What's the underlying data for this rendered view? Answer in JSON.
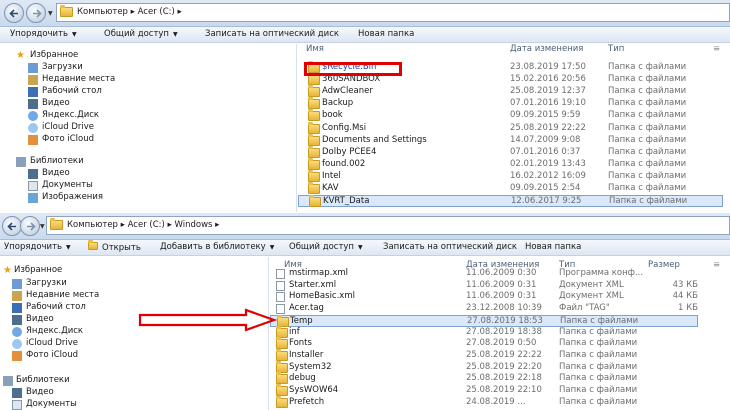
{
  "top": {
    "crumbs": [
      "Компьютер",
      "Acer (C:)"
    ],
    "toolbar": [
      "Упорядочить",
      "Общий доступ",
      "Записать на оптический диск",
      "Новая папка"
    ],
    "columns": {
      "name": "Имя",
      "date": "Дата изменения",
      "type": "Тип"
    },
    "nav": [
      {
        "label": "Избранное",
        "icon": "star-icon"
      },
      {
        "label": "Загрузки",
        "icon": "downloads-icon"
      },
      {
        "label": "Недавние места",
        "icon": "recent-places-icon"
      },
      {
        "label": "Рабочий стол",
        "icon": "desktop-icon"
      },
      {
        "label": "Видео",
        "icon": "video-icon"
      },
      {
        "label": "Яндекс.Диск",
        "icon": "yandex-disk-icon"
      },
      {
        "label": "iCloud Drive",
        "icon": "icloud-icon"
      },
      {
        "label": "Фото iCloud",
        "icon": "icloud-photos-icon"
      },
      {
        "label": "Библиотеки",
        "icon": "libraries-icon"
      },
      {
        "label": "Видео",
        "icon": "video-icon"
      },
      {
        "label": "Документы",
        "icon": "documents-icon"
      },
      {
        "label": "Изображения",
        "icon": "pictures-icon"
      }
    ],
    "files": [
      {
        "name": "$Recycle.Bin",
        "date": "23.08.2019 17:50",
        "type": "Папка с файлами"
      },
      {
        "name": "360SANDBOX",
        "date": "15.02.2016 20:56",
        "type": "Папка с файлами"
      },
      {
        "name": "AdwCleaner",
        "date": "25.08.2019 12:37",
        "type": "Папка с файлами"
      },
      {
        "name": "Backup",
        "date": "07.01.2016 19:10",
        "type": "Папка с файлами"
      },
      {
        "name": "book",
        "date": "09.09.2015 9:59",
        "type": "Папка с файлами"
      },
      {
        "name": "Config.Msi",
        "date": "25.08.2019 22:22",
        "type": "Папка с файлами"
      },
      {
        "name": "Documents and Settings",
        "date": "14.07.2009 9:08",
        "type": "Папка с файлами"
      },
      {
        "name": "Dolby PCEE4",
        "date": "07.01.2016 0:37",
        "type": "Папка с файлами"
      },
      {
        "name": "found.002",
        "date": "02.01.2019 13:43",
        "type": "Папка с файлами"
      },
      {
        "name": "Intel",
        "date": "16.02.2012 16:09",
        "type": "Папка с файлами"
      },
      {
        "name": "KAV",
        "date": "09.09.2015 2:54",
        "type": "Папка с файлами"
      },
      {
        "name": "KVRT_Data",
        "date": "12.06.2017 9:25",
        "type": "Папка с файлами"
      }
    ]
  },
  "bottom": {
    "crumbs": [
      "Компьютер",
      "Acer (C:)",
      "Windows"
    ],
    "toolbar": [
      "Упорядочить",
      "Открыть",
      "Добавить в библиотеку",
      "Общий доступ",
      "Записать на оптический диск",
      "Новая папка"
    ],
    "columns": {
      "name": "Имя",
      "date": "Дата изменения",
      "type": "Тип",
      "size": "Размер"
    },
    "nav": [
      {
        "label": "Избранное",
        "icon": "star-icon"
      },
      {
        "label": "Загрузки",
        "icon": "downloads-icon"
      },
      {
        "label": "Недавние места",
        "icon": "recent-places-icon"
      },
      {
        "label": "Рабочий стол",
        "icon": "desktop-icon"
      },
      {
        "label": "Видео",
        "icon": "video-icon"
      },
      {
        "label": "Яндекс.Диск",
        "icon": "yandex-disk-icon"
      },
      {
        "label": "iCloud Drive",
        "icon": "icloud-icon"
      },
      {
        "label": "Фото iCloud",
        "icon": "icloud-photos-icon"
      },
      {
        "label": "Библиотеки",
        "icon": "libraries-icon"
      },
      {
        "label": "Видео",
        "icon": "video-icon"
      },
      {
        "label": "Документы",
        "icon": "documents-icon"
      }
    ],
    "files": [
      {
        "name": "mstirmap.xml",
        "date": "11.06.2009 0:30",
        "type": "Программа конф...",
        "size": "",
        "kind": "file"
      },
      {
        "name": "Starter.xml",
        "date": "11.06.2009 0:31",
        "type": "Документ XML",
        "size": "43 КБ",
        "kind": "file"
      },
      {
        "name": "HomeBasic.xml",
        "date": "11.06.2009 0:31",
        "type": "Документ XML",
        "size": "44 КБ",
        "kind": "file"
      },
      {
        "name": "Acer.tag",
        "date": "23.12.2008 10:39",
        "type": "Файл \"TAG\"",
        "size": "1 КБ",
        "kind": "file"
      },
      {
        "name": "Temp",
        "date": "27.08.2019 18:53",
        "type": "Папка с файлами",
        "size": "",
        "kind": "folder"
      },
      {
        "name": "inf",
        "date": "27.08.2019 18:38",
        "type": "Папка с файлами",
        "size": "",
        "kind": "folder"
      },
      {
        "name": "Fonts",
        "date": "27.08.2019 0:50",
        "type": "Папка с файлами",
        "size": "",
        "kind": "folder"
      },
      {
        "name": "Installer",
        "date": "25.08.2019 22:22",
        "type": "Папка с файлами",
        "size": "",
        "kind": "folder"
      },
      {
        "name": "System32",
        "date": "25.08.2019 22:20",
        "type": "Папка с файлами",
        "size": "",
        "kind": "folder"
      },
      {
        "name": "debug",
        "date": "25.08.2019 22:18",
        "type": "Папка с файлами",
        "size": "",
        "kind": "folder"
      },
      {
        "name": "SysWOW64",
        "date": "25.08.2019 22:10",
        "type": "Папка с файлами",
        "size": "",
        "kind": "folder"
      },
      {
        "name": "Prefetch",
        "date": "24.08.2019 ...",
        "type": "Папка с файлами",
        "size": "",
        "kind": "folder"
      }
    ]
  },
  "colors": {
    "highlight": "#e00000",
    "selection": "#d9e8fb",
    "folder": "#f0c850"
  }
}
